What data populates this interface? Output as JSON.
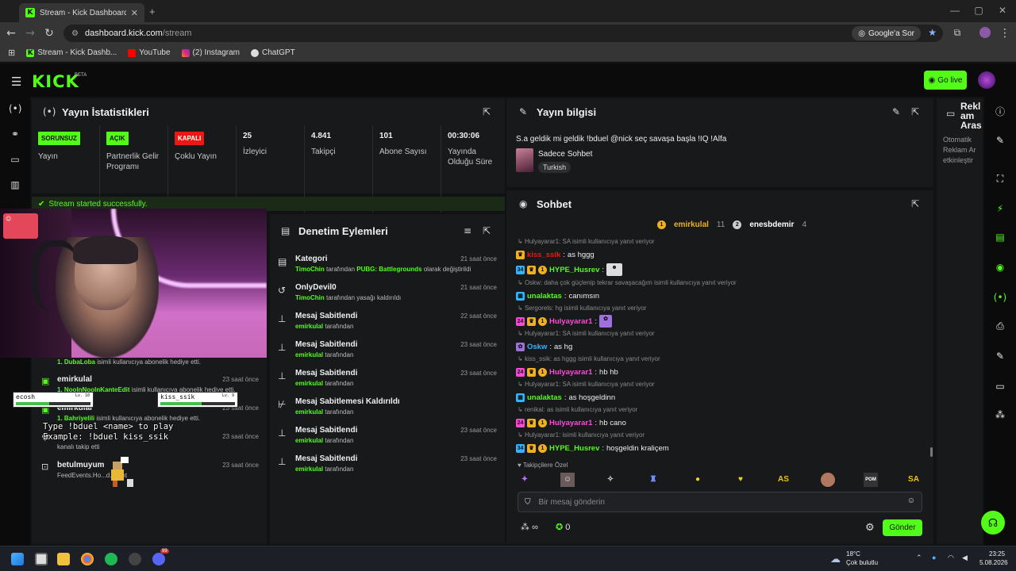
{
  "browser": {
    "tab_title": "Stream - Kick Dashboard",
    "url_host": "dashboard.kick.com",
    "url_path": "/stream",
    "google_sor": "Google'a Sor",
    "bookmarks": [
      "Stream - Kick Dashb...",
      "YouTube",
      "(2) Instagram",
      "ChatGPT"
    ]
  },
  "header": {
    "logo": "KICK",
    "beta": "BETA",
    "go_live": "Go live"
  },
  "stats": {
    "title": "Yayın İstatistikleri",
    "items": [
      {
        "badge": "SORUNSUZ",
        "label": "Yayın"
      },
      {
        "badge": "AÇIK",
        "label": "Partnerlik Gelir Programı"
      },
      {
        "badge": "KAPALI",
        "label": "Çoklu Yayın"
      },
      {
        "value": "25",
        "label": "İzleyici"
      },
      {
        "value": "4.841",
        "label": "Takipçi"
      },
      {
        "value": "101",
        "label": "Abone Sayısı"
      },
      {
        "value": "00:30:06",
        "label": "Yayında Olduğu Süre"
      }
    ],
    "success": "Stream started successfully."
  },
  "feed": {
    "items": [
      {
        "name": "",
        "desc_user": "1. DubaLoba",
        "desc": "isimli kullanıcıya abonelik hediye etti.",
        "time": ""
      },
      {
        "name": "emirkulal",
        "desc_user": "1. NoolnNoolnKanteEdit",
        "desc": "isimli kullanıcıya abonelik hediye etti.",
        "time": "23 saat önce"
      },
      {
        "name": "emirkulal",
        "desc_user": "1. Bahriyelili",
        "desc": "isimli kullanıcıya abonelik hediye etti.",
        "time": "23 saat önce"
      },
      {
        "name": "",
        "desc_user": "",
        "desc": "kanalı takip etti",
        "time": "23 saat önce"
      },
      {
        "name": "betulmuyum",
        "desc_user": "",
        "desc": "FeedEvents.Ho...d.event",
        "time": "23 saat önce"
      }
    ]
  },
  "duel": {
    "p1": "ecosh",
    "p1_lv": "Lv. 10",
    "p1_hp": 0.45,
    "p2": "kiss_ssik",
    "p2_lv": "Lv. 9",
    "p2_hp": 0.55,
    "instructions": "Type !bduel <name> to play\nExample: !bduel kiss_ssik"
  },
  "moderation": {
    "title": "Denetim Eylemleri",
    "items": [
      {
        "icon": "category-icon",
        "title": "Kategori",
        "user": "TimoChin",
        "desc": "tarafından",
        "extra_user": "PUBG: Battlegrounds",
        "extra": "olarak değiştirildi",
        "time": "21 saat önce"
      },
      {
        "icon": "unban-icon",
        "title": "OnlyDevil0",
        "user": "TimoChin",
        "desc": "tarafından yasağı kaldırıldı",
        "extra_user": "",
        "extra": "",
        "time": "21 saat önce"
      },
      {
        "icon": "pin-icon",
        "title": "Mesaj Sabitlendi",
        "user": "emirkulal",
        "desc": "tarafından",
        "extra_user": "",
        "extra": "",
        "time": "22 saat önce"
      },
      {
        "icon": "pin-icon",
        "title": "Mesaj Sabitlendi",
        "user": "emirkulal",
        "desc": "tarafından",
        "extra_user": "",
        "extra": "",
        "time": "23 saat önce"
      },
      {
        "icon": "pin-icon",
        "title": "Mesaj Sabitlendi",
        "user": "emirkulal",
        "desc": "tarafından",
        "extra_user": "",
        "extra": "",
        "time": "23 saat önce"
      },
      {
        "icon": "unpin-icon",
        "title": "Mesaj Sabitlemesi Kaldırıldı",
        "user": "emirkulal",
        "desc": "tarafından",
        "extra_user": "",
        "extra": "",
        "time": ""
      },
      {
        "icon": "pin-icon",
        "title": "Mesaj Sabitlendi",
        "user": "emirkulal",
        "desc": "tarafından",
        "extra_user": "",
        "extra": "",
        "time": "23 saat önce"
      },
      {
        "icon": "pin-icon",
        "title": "Mesaj Sabitlendi",
        "user": "emirkulal",
        "desc": "tarafından",
        "extra_user": "",
        "extra": "",
        "time": "23 saat önce"
      }
    ]
  },
  "info": {
    "title": "Yayın bilgisi",
    "stream_title": "S.a geldik mi geldik !bduel @nick seç savaşa başla !IQ !Alfa",
    "category": "Sadece Sohbet",
    "language": "Turkish"
  },
  "chat": {
    "title": "Sohbet",
    "top": [
      {
        "name": "emirkulal",
        "count": "11"
      },
      {
        "name": "enesbdemir",
        "count": "4"
      }
    ],
    "messages": [
      {
        "reply": "Hulyayarar1: SA isimli kullanıcıya yanıt veriyor",
        "user": "kiss_ssik",
        "color": "#e91916",
        "text": "as hggg"
      },
      {
        "reply": "",
        "user": "HYPE_Husrev",
        "color": "#53fc18",
        "text": ""
      },
      {
        "reply": "Oskw: daha çok güçlenip tekrar savaşacağım isimli kullanıcıya yanıt veriyor",
        "user": "unalaktas",
        "color": "#53fc18",
        "text": "canımsın"
      },
      {
        "reply": "Sergorels: hg isimli kullanıcıya yanıt veriyor",
        "user": "Hulyayarar1",
        "color": "#ff48d8",
        "text": ""
      },
      {
        "reply": "Hulyayarar1: SA isimli kullanıcıya yanıt veriyor",
        "user": "Oskw",
        "color": "#34b3ff",
        "text": "as hg"
      },
      {
        "reply": "kiss_ssik: as hggg isimli kullanıcıya yanıt veriyor",
        "user": "Hulyayarar1",
        "color": "#ff48d8",
        "text": "hb hb"
      },
      {
        "reply": "Hulyayarar1: SA isimli kullanıcıya yanıt veriyor",
        "user": "unalaktas",
        "color": "#53fc18",
        "text": "as hoşgeldinn"
      },
      {
        "reply": "renikal: as isimli kullanıcıya yanıt veriyor",
        "user": "Hulyayarar1",
        "color": "#ff48d8",
        "text": "hb cano"
      },
      {
        "reply": "Hulyayarar1: isimli kullanıcıya yanıt veriyor",
        "user": "HYPE_Husrev",
        "color": "#53fc18",
        "text": "hoşgeldin kraliçem"
      }
    ],
    "emote_header": "Takipçilere Özel",
    "placeholder": "Bir mesaj gönderin",
    "points_label": "∞",
    "count_label": "0",
    "send": "Gönder"
  },
  "ad": {
    "title": "Reklam Aras",
    "desc": "Otomatik Reklam Ar etkinleştir"
  },
  "taskbar": {
    "temp": "18°C",
    "weather": "Çok bulutlu",
    "time": "23:25",
    "date": "5.08.2026",
    "spotify_badge": "",
    "discord_badge": "99"
  },
  "colors": {
    "accent": "#53fc18",
    "panel": "#18191b",
    "bg": "#111214",
    "danger": "#e91916"
  }
}
